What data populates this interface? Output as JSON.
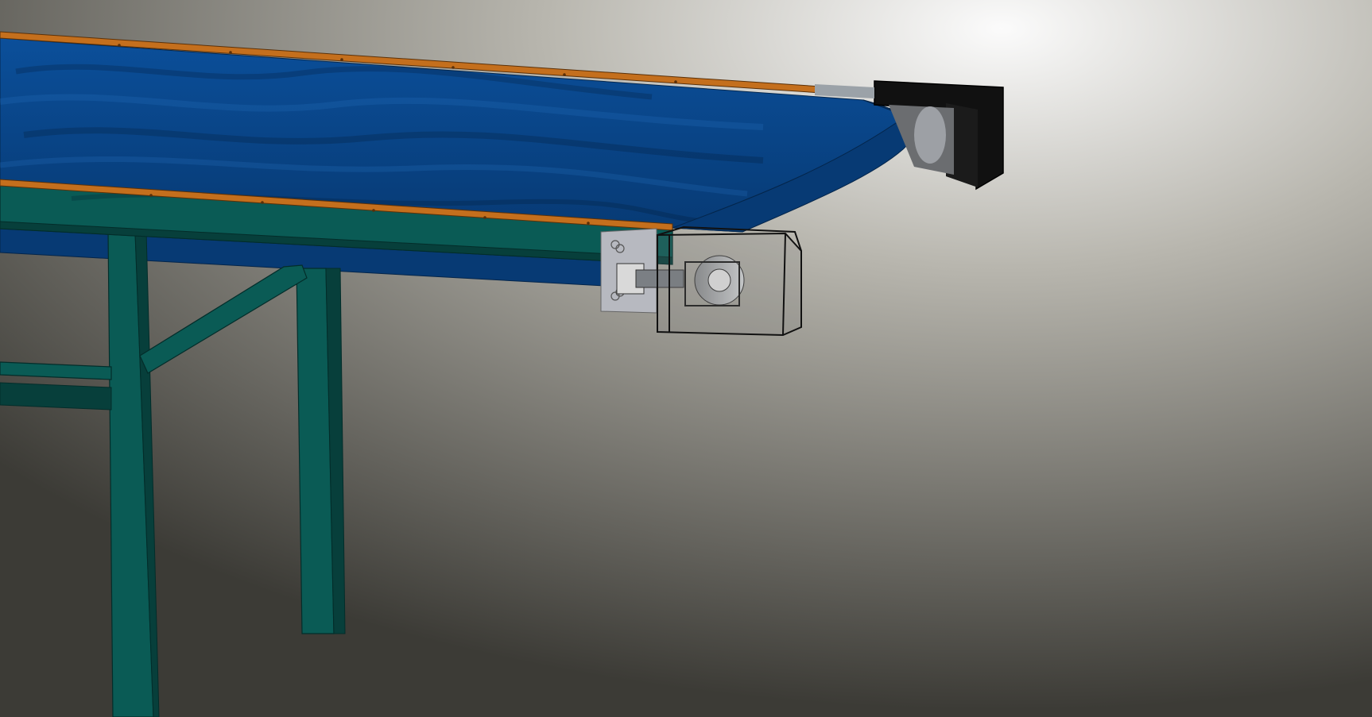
{
  "scene": {
    "subject": "belt-conveyor-3d-model",
    "colors": {
      "belt": "#0b4f9a",
      "belt_shadow": "#073a74",
      "frame": "#0a5b55",
      "frame_dark": "#073f3b",
      "side_rail": "#c46f1d",
      "drive_housing": "#111111",
      "bracket_plate": "#b7b9c0",
      "background_light": "#fbfbfb",
      "background_mid": "#b8b6ae",
      "background_dark": "#3c3b36"
    },
    "icons": {
      "motor_cover": "transparent-box",
      "end_cap": "black-housing"
    }
  }
}
